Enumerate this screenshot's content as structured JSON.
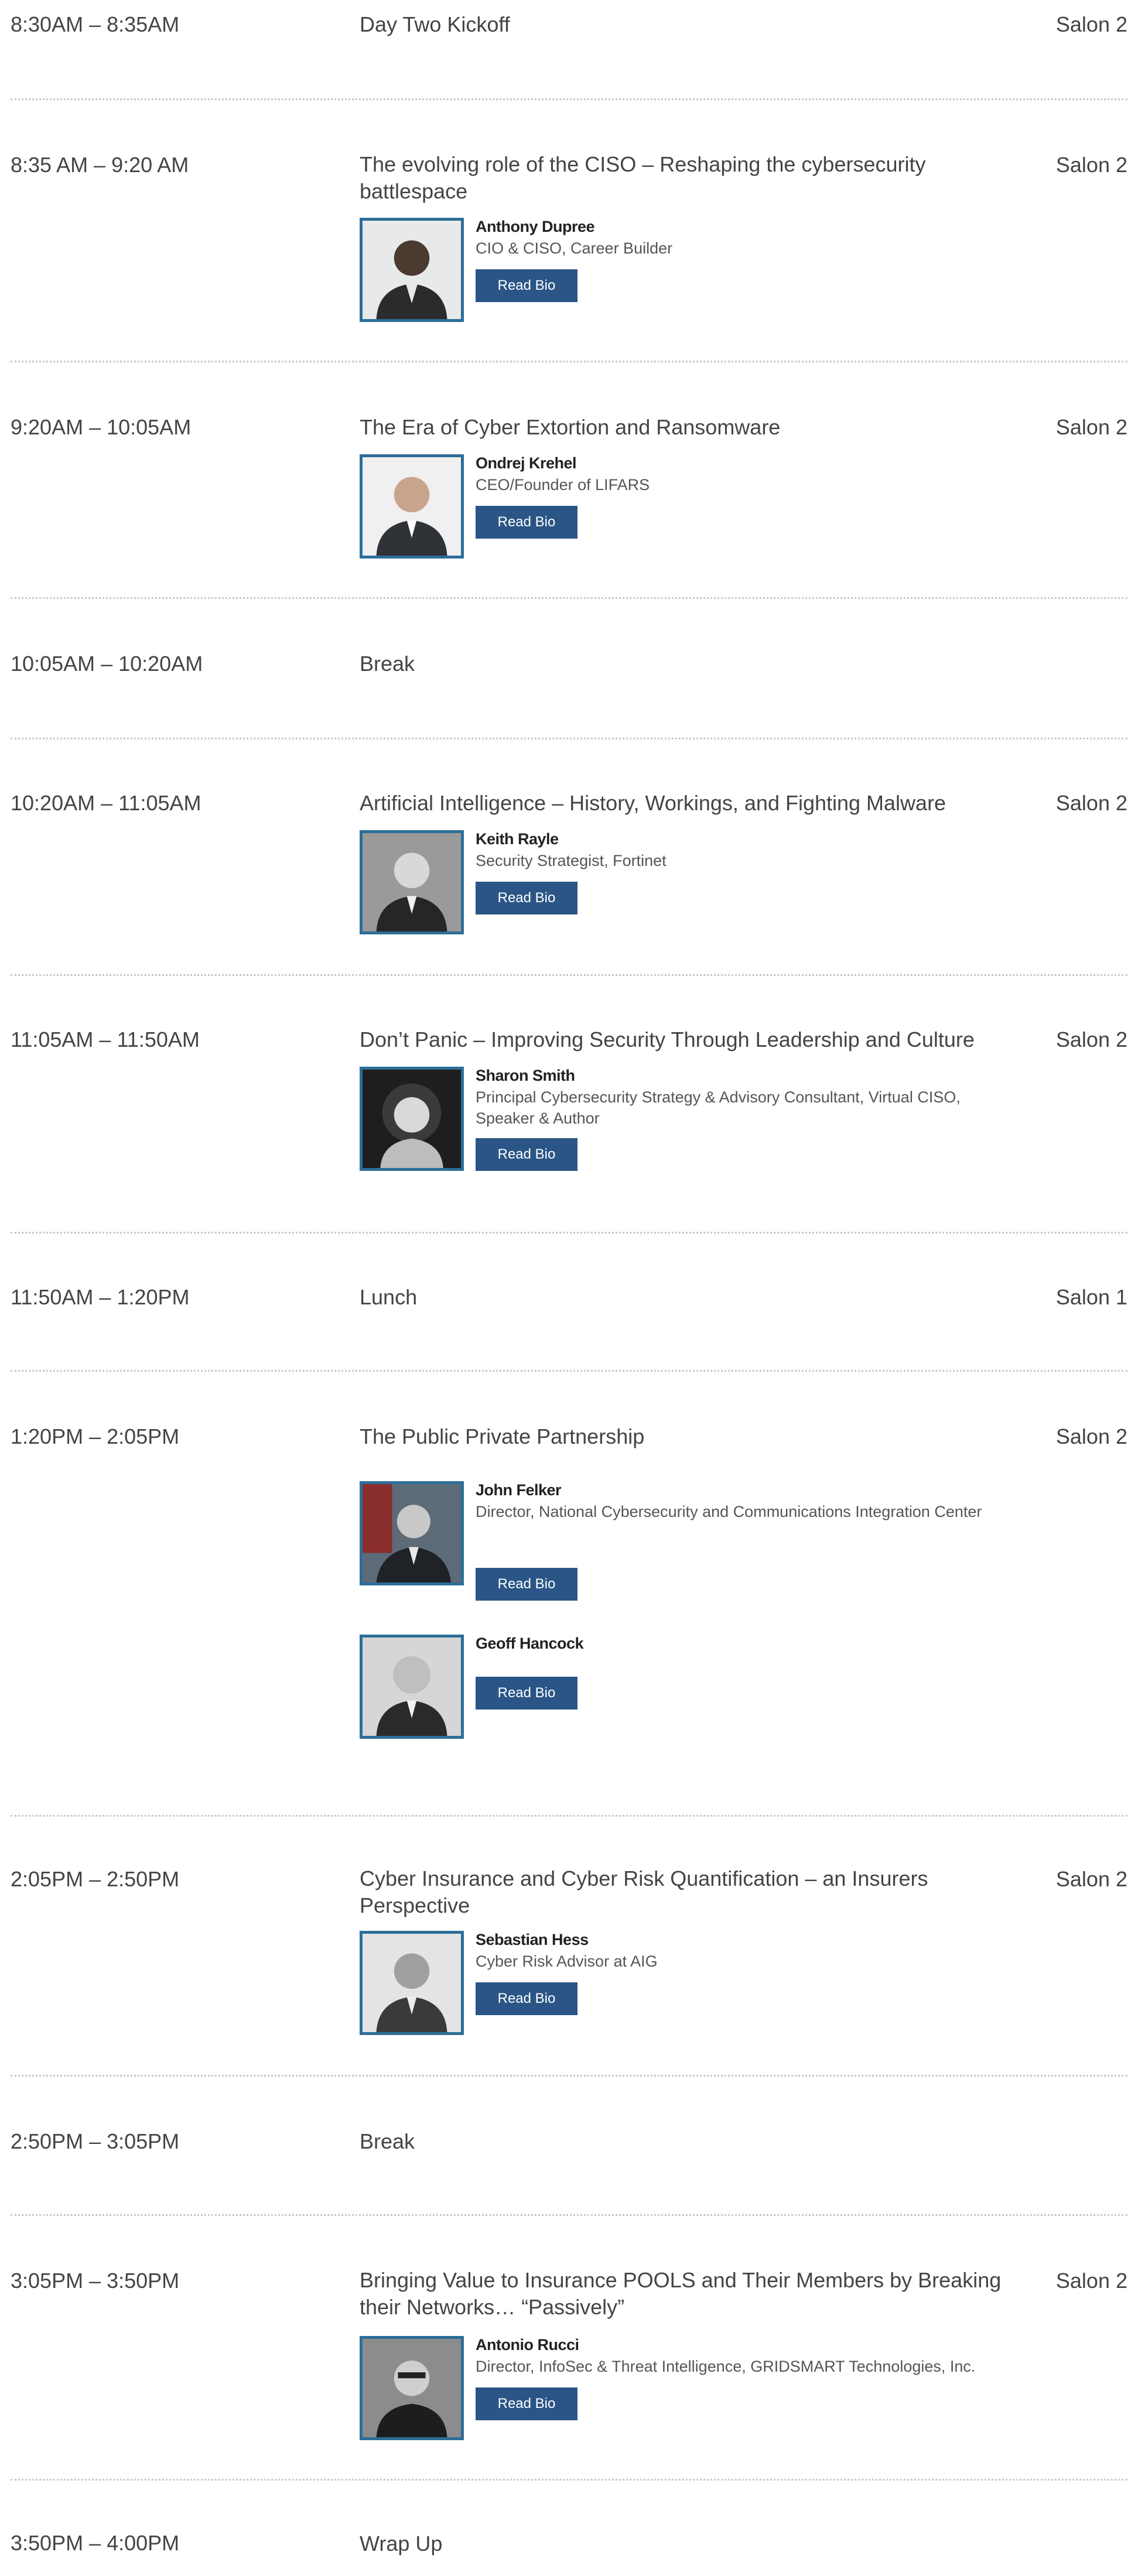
{
  "read_bio_label": "Read Bio",
  "sessions": [
    {
      "time": "8:30AM – 8:35AM",
      "title": "Day Two Kickoff",
      "room": "Salon 2"
    },
    {
      "time": "8:35 AM – 9:20 AM",
      "title": "The evolving role of the CISO – Reshaping the cybersecurity battlespace",
      "room": "Salon 2",
      "speakers": [
        {
          "name": "Anthony Dupree",
          "role": "CIO & CISO, Career Builder"
        }
      ]
    },
    {
      "time": "9:20AM – 10:05AM",
      "title": "The Era of Cyber Extortion and Ransomware",
      "room": "Salon 2",
      "speakers": [
        {
          "name": "Ondrej Krehel",
          "role": "CEO/Founder of LIFARS"
        }
      ]
    },
    {
      "time": "10:05AM – 10:20AM",
      "title": "Break",
      "room": ""
    },
    {
      "time": "10:20AM – 11:05AM",
      "title": "Artificial Intelligence – History, Workings, and Fighting Malware",
      "room": "Salon 2",
      "speakers": [
        {
          "name": "Keith Rayle",
          "role": "Security Strategist, Fortinet"
        }
      ]
    },
    {
      "time": "11:05AM – 11:50AM",
      "title": "Don’t Panic – Improving Security Through Leadership and Culture",
      "room": "Salon 2",
      "speakers": [
        {
          "name": "Sharon Smith",
          "role": "Principal Cybersecurity Strategy & Advisory Consultant, Virtual CISO, Speaker & Author"
        }
      ]
    },
    {
      "time": "11:50AM – 1:20PM",
      "title": "Lunch",
      "room": "Salon 1"
    },
    {
      "time": "1:20PM – 2:05PM",
      "title": "The Public Private Partnership",
      "room": "Salon 2",
      "speakers": [
        {
          "name": "John Felker",
          "role": "Director, National Cybersecurity and Communications Integration Center"
        },
        {
          "name": "Geoff Hancock",
          "role": ""
        }
      ]
    },
    {
      "time": "2:05PM – 2:50PM",
      "title": "Cyber Insurance and Cyber Risk Quantification – an Insurers Perspective",
      "room": "Salon 2",
      "speakers": [
        {
          "name": "Sebastian Hess",
          "role": "Cyber Risk Advisor at AIG"
        }
      ]
    },
    {
      "time": "2:50PM – 3:05PM",
      "title": "Break",
      "room": ""
    },
    {
      "time": "3:05PM – 3:50PM",
      "title": "Bringing Value to Insurance POOLS and Their Members by Breaking their Networks… “Passively”",
      "room": "Salon 2",
      "speakers": [
        {
          "name": "Antonio Rucci",
          "role": "Director, InfoSec & Threat Intelligence, GRIDSMART Technologies, Inc."
        }
      ]
    },
    {
      "time": "3:50PM – 4:00PM",
      "title": "Wrap Up",
      "room": ""
    }
  ]
}
